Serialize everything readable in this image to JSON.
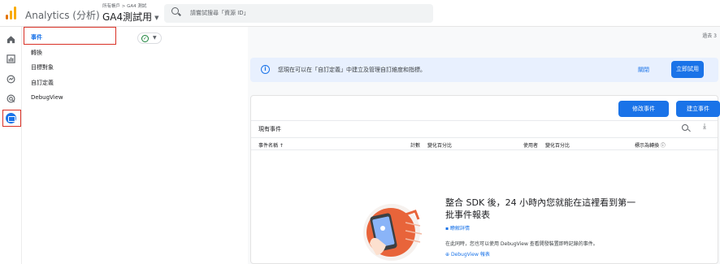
{
  "header": {
    "app_title": "Analytics (分析)",
    "breadcrumb": "所有帳戶 > GA4 測試",
    "property_name": "GA4測試用",
    "search_placeholder": "請嘗試搜尋「資源 ID」"
  },
  "rail": {
    "icons": [
      "home-icon",
      "reports-icon",
      "explore-icon",
      "advertising-icon",
      "configure-icon"
    ]
  },
  "subnav": {
    "items": [
      {
        "label": "事件",
        "active": true
      },
      {
        "label": "轉換"
      },
      {
        "label": "目標對象"
      },
      {
        "label": "自訂定義"
      },
      {
        "label": "DebugView"
      }
    ],
    "status_icon": "check-circle-icon"
  },
  "main": {
    "overflow_text": "過去 3",
    "banner": {
      "message": "您現在可以在「自訂定義」中建立及管理自訂維度和指標。",
      "dismiss_label": "關閉",
      "try_label": "立即試用"
    },
    "buttons": {
      "modify_event": "修改事件",
      "create_event": "建立事件"
    },
    "section_title": "現有事件",
    "columns": [
      {
        "label": "事件名稱 ↑"
      },
      {
        "label": "計數"
      },
      {
        "label": "變化百分比"
      },
      {
        "label": "使用者"
      },
      {
        "label": "變化百分比"
      },
      {
        "label": "標示為轉換 ⓘ"
      }
    ],
    "empty_state": {
      "title": "整合 SDK 後，24 小時內您就能在這裡看到第一批事件報表",
      "link_learn": "瞭解詳情",
      "description": "在此同時，您也可以使用 DebugView 查看開發裝置即時記錄的事件。",
      "link_debug": "DebugView 報表"
    }
  },
  "colors": {
    "accent": "#1a73e8",
    "highlight": "#d93025",
    "banner_bg": "#e8f0fe",
    "logo_orange": "#f9ab00",
    "logo_dark": "#e37400"
  }
}
